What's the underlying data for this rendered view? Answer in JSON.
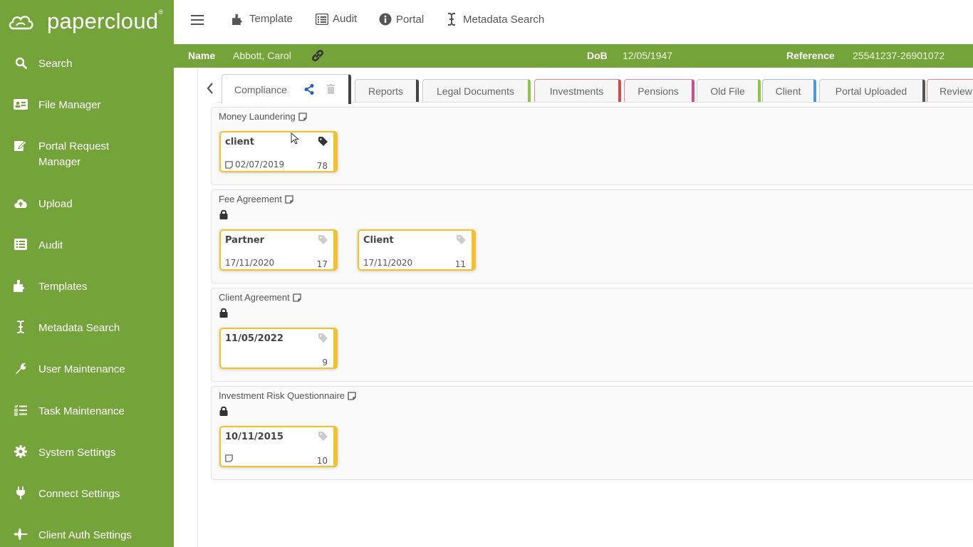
{
  "app": {
    "logo": "papercloud",
    "logo_mark": "®"
  },
  "sidebar": {
    "items": [
      {
        "label": "Search",
        "icon": "search-icon"
      },
      {
        "label": "File Manager",
        "icon": "id-card-icon"
      },
      {
        "label": "Portal Request Manager",
        "icon": "edit-icon"
      },
      {
        "label": "Upload",
        "icon": "cloud-upload-icon"
      },
      {
        "label": "Audit",
        "icon": "list-icon"
      },
      {
        "label": "Templates",
        "icon": "puzzle-icon"
      },
      {
        "label": "Metadata Search",
        "icon": "text-cursor-icon"
      },
      {
        "label": "User Maintenance",
        "icon": "wrench-icon"
      },
      {
        "label": "Task Maintenance",
        "icon": "tasks-icon"
      },
      {
        "label": "System Settings",
        "icon": "gear-icon"
      },
      {
        "label": "Connect Settings",
        "icon": "plug-icon"
      },
      {
        "label": "Client Auth Settings",
        "icon": "plane-icon"
      }
    ]
  },
  "topbar": {
    "links": [
      {
        "label": "Template",
        "icon": "puzzle-icon"
      },
      {
        "label": "Audit",
        "icon": "list-icon"
      },
      {
        "label": "Portal",
        "icon": "info-icon"
      },
      {
        "label": "Metadata Search",
        "icon": "text-cursor-icon"
      }
    ]
  },
  "client": {
    "name_label": "Name",
    "name": "Abbott, Carol",
    "dob_label": "DoB",
    "dob": "12/05/1947",
    "ref_label": "Reference",
    "ref": "25541237-26901072"
  },
  "tabs": [
    {
      "label": "Compliance",
      "color": "#444444",
      "active": true
    },
    {
      "label": "Reports",
      "color": "#444444"
    },
    {
      "label": "Legal Documents",
      "color": "#8dc63f"
    },
    {
      "label": "Investments",
      "color": "#d94a4a"
    },
    {
      "label": "Pensions",
      "color": "#d9488a"
    },
    {
      "label": "Old File",
      "color": "#8dc63f"
    },
    {
      "label": "Client",
      "color": "#4a9bd9"
    },
    {
      "label": "Portal Uploaded",
      "color": "#555555"
    },
    {
      "label": "Review",
      "color": "#d94a4a"
    }
  ],
  "sections": [
    {
      "title": "Money Laundering",
      "locked": false,
      "cards": [
        {
          "title": "client",
          "date": "02/07/2019",
          "count": "78",
          "tagged": true,
          "note": true
        }
      ]
    },
    {
      "title": "Fee Agreement",
      "locked": true,
      "cards": [
        {
          "title": "Partner",
          "date": "17/11/2020",
          "count": "17",
          "tagged": false,
          "note": false
        },
        {
          "title": "Client",
          "date": "17/11/2020",
          "count": "11",
          "tagged": false,
          "note": false
        }
      ]
    },
    {
      "title": "Client Agreement",
      "locked": true,
      "cards": [
        {
          "title": "11/05/2022",
          "date": "",
          "count": "9",
          "tagged": false,
          "note": false
        }
      ]
    },
    {
      "title": "Investment Risk Questionnaire",
      "locked": true,
      "cards": [
        {
          "title": "10/11/2015",
          "date": "",
          "count": "10",
          "tagged": false,
          "note": true
        }
      ]
    }
  ],
  "colors": {
    "brand_green": "#74a33a",
    "card_accent": "#f3c12a",
    "share_blue": "#1f5fbf"
  }
}
